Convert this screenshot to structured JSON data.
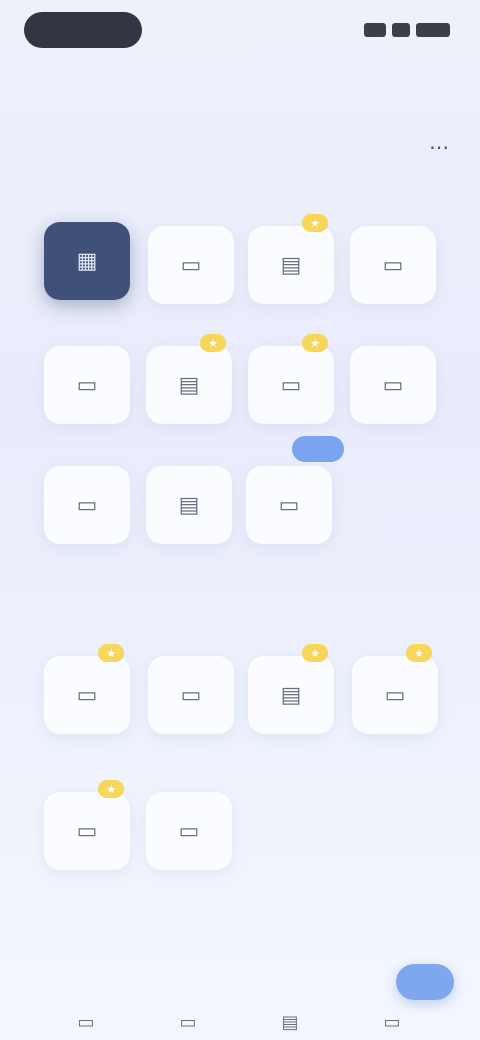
{
  "header": {
    "title": "",
    "action_icon": "more-icon"
  },
  "sections": {
    "recent_label": "",
    "popular_label": "",
    "more_label": ""
  },
  "recent_tiles": [
    {
      "icon": "app-icon-primary",
      "label": "",
      "dark": true
    },
    {
      "icon": "app-icon",
      "label": ""
    },
    {
      "icon": "app-icon",
      "label": ""
    },
    {
      "icon": "app-icon",
      "label": ""
    },
    {
      "icon": "app-icon",
      "label": ""
    },
    {
      "icon": "app-icon",
      "label": ""
    },
    {
      "icon": "app-icon",
      "label": ""
    },
    {
      "icon": "app-icon",
      "label": ""
    },
    {
      "icon": "app-icon",
      "label": ""
    },
    {
      "icon": "app-icon",
      "label": ""
    },
    {
      "icon": "app-icon",
      "label": ""
    }
  ],
  "popular_tiles": [
    {
      "icon": "app-icon",
      "label": ""
    },
    {
      "icon": "app-icon",
      "label": ""
    },
    {
      "icon": "app-icon",
      "label": ""
    },
    {
      "icon": "app-icon",
      "label": ""
    },
    {
      "icon": "app-icon",
      "label": ""
    },
    {
      "icon": "app-icon",
      "label": ""
    }
  ],
  "badges": {
    "star": "★",
    "new": ""
  },
  "fab": {
    "label": ""
  },
  "colors": {
    "accent": "#7fa7ee",
    "dark_tile": "#3f5178",
    "star_badge": "#f7d65a"
  }
}
